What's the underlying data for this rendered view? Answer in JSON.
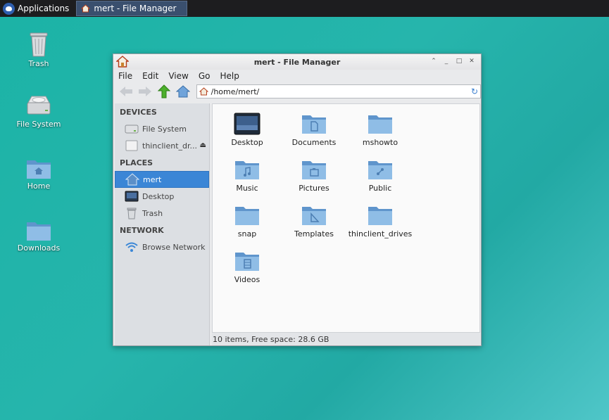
{
  "panel": {
    "apps_label": "Applications",
    "task_label": "mert - File Manager"
  },
  "desktop": {
    "icons": [
      {
        "label": "Trash",
        "icon": "trash-icon"
      },
      {
        "label": "File System",
        "icon": "drive-icon"
      },
      {
        "label": "Home",
        "icon": "home-folder-icon"
      },
      {
        "label": "Downloads",
        "icon": "folder-icon"
      }
    ]
  },
  "window": {
    "title": "mert - File Manager",
    "menu": [
      "File",
      "Edit",
      "View",
      "Go",
      "Help"
    ],
    "address": "/home/mert/",
    "sidebar": {
      "devices_header": "DEVICES",
      "devices": [
        "File System",
        "thinclient_dr..."
      ],
      "places_header": "PLACES",
      "places": [
        "mert",
        "Desktop",
        "Trash"
      ],
      "network_header": "NETWORK",
      "network": [
        "Browse Network"
      ]
    },
    "files": [
      "Desktop",
      "Documents",
      "mshowto",
      "Music",
      "Pictures",
      "Public",
      "snap",
      "Templates",
      "thinclient_drives",
      "Videos"
    ],
    "status": "10 items, Free space: 28.6 GB"
  },
  "colors": {
    "desktop_bg": "#1bb3a6",
    "panel_bg": "#1d1d1f",
    "selection": "#3b86d6",
    "folder_blue": "#7fb1e0"
  }
}
